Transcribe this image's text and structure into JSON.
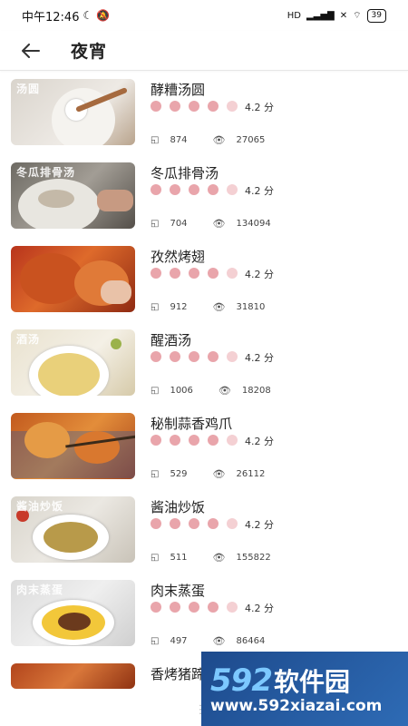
{
  "status_bar": {
    "time": "中午12:46",
    "battery": "39",
    "signal": "HD"
  },
  "header": {
    "back_icon": "arrow-left-icon",
    "title": "夜宵"
  },
  "items": [
    {
      "name": "酵糟汤圆",
      "score": "4.2 分",
      "favorites": "874",
      "views": "27065",
      "image_caption": "汤圆"
    },
    {
      "name": "冬瓜排骨汤",
      "score": "4.2 分",
      "favorites": "704",
      "views": "134094",
      "image_caption": "冬瓜排骨汤"
    },
    {
      "name": "孜然烤翅",
      "score": "4.2 分",
      "favorites": "912",
      "views": "31810",
      "image_caption": ""
    },
    {
      "name": "醒酒汤",
      "score": "4.2 分",
      "favorites": "1006",
      "views": "18208",
      "image_caption": "酒汤"
    },
    {
      "name": "秘制蒜香鸡爪",
      "score": "4.2 分",
      "favorites": "529",
      "views": "26112",
      "image_caption": ""
    },
    {
      "name": "酱油炒饭",
      "score": "4.2 分",
      "favorites": "511",
      "views": "155822",
      "image_caption": "酱油炒饭"
    },
    {
      "name": "肉末蒸蛋",
      "score": "4.2 分",
      "favorites": "497",
      "views": "86464",
      "image_caption": "肉末蒸蛋"
    },
    {
      "name": "香烤猪蹄",
      "score": "",
      "favorites": "",
      "views": "",
      "image_caption": ""
    }
  ],
  "rating": {
    "filled": 4,
    "total": 5
  },
  "watermark": {
    "number": "592",
    "text": "软件园",
    "url": "www.592xiazai.com"
  },
  "colors": {
    "star_filled": "#e9a5ab",
    "star_dim": "#f4d0d3",
    "watermark_bg": "#2e6bb5"
  }
}
